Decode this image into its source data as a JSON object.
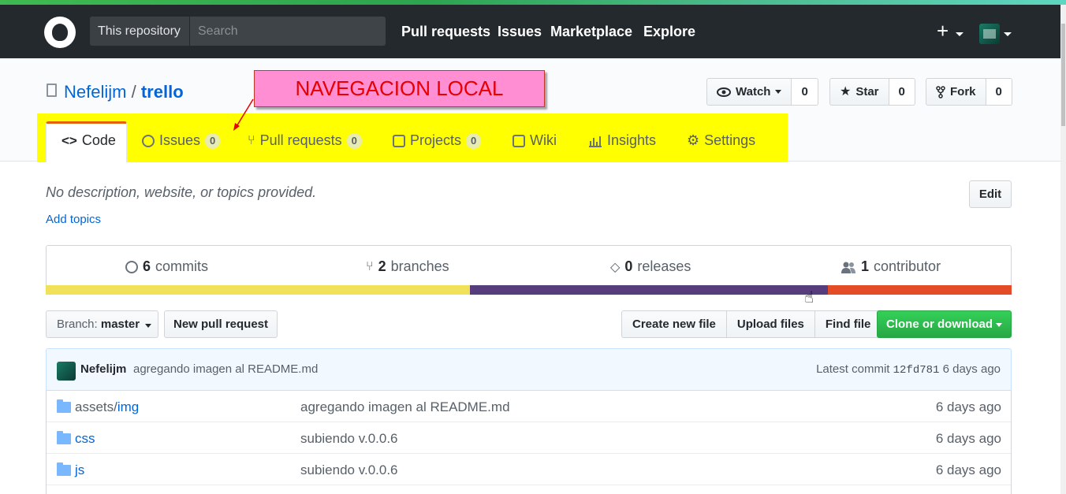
{
  "header": {
    "search_scope": "This repository",
    "search_placeholder": "Search",
    "nav": [
      "Pull requests",
      "Issues",
      "Marketplace",
      "Explore"
    ],
    "plus": "+"
  },
  "repo": {
    "owner": "Nefelijm",
    "separator": "/",
    "name": "trello",
    "watch_label": "Watch",
    "watch_count": "0",
    "star_label": "Star",
    "star_count": "0",
    "fork_label": "Fork",
    "fork_count": "0"
  },
  "annotation": {
    "text": "NAVEGACION LOCAL",
    "color": "#ff8ed2"
  },
  "tabs": [
    {
      "label": "Code"
    },
    {
      "label": "Issues",
      "count": "0"
    },
    {
      "label": "Pull requests",
      "count": "0"
    },
    {
      "label": "Projects",
      "count": "0"
    },
    {
      "label": "Wiki"
    },
    {
      "label": "Insights"
    },
    {
      "label": "Settings"
    }
  ],
  "about": {
    "description": "No description, website, or topics provided.",
    "add_topics": "Add topics",
    "edit_label": "Edit"
  },
  "summary": {
    "commits_count": "6",
    "commits_label": "commits",
    "branches_count": "2",
    "branches_label": "branches",
    "releases_count": "0",
    "releases_label": "releases",
    "contributors_count": "1",
    "contributors_label": "contributor"
  },
  "languages": [
    {
      "color": "#f1e05a",
      "share": 0.439
    },
    {
      "color": "#563d7c",
      "share": 0.371
    },
    {
      "color": "#e34c26",
      "share": 0.19
    }
  ],
  "toolbar": {
    "branch_prefix": "Branch:",
    "branch_name": "master",
    "new_pr": "New pull request",
    "create_file": "Create new file",
    "upload_files": "Upload files",
    "find_file": "Find file",
    "clone": "Clone or download"
  },
  "commit": {
    "author": "Nefelijm",
    "message": "agregando imagen al README.md",
    "latest_label": "Latest commit",
    "sha": "12fd781",
    "age": "6 days ago"
  },
  "files": [
    {
      "dir": "assets/",
      "name": "img",
      "message": "agregando imagen al README.md",
      "age": "6 days ago"
    },
    {
      "dir": "",
      "name": "css",
      "message": "subiendo v.0.0.6",
      "age": "6 days ago"
    },
    {
      "dir": "",
      "name": "js",
      "message": "subiendo v.0.0.6",
      "age": "6 days ago"
    }
  ]
}
